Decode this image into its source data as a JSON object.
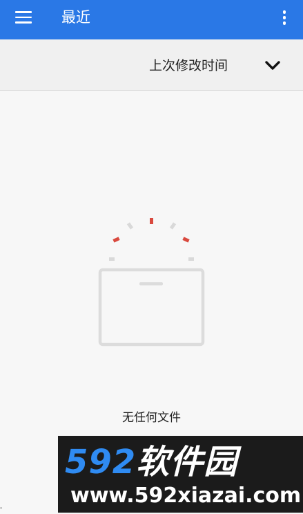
{
  "header": {
    "title": "最近",
    "menu_icon": "menu-icon",
    "more_icon": "more-vert-icon",
    "background_color": "#2a78e6"
  },
  "sort_bar": {
    "label": "上次修改时间",
    "toggle_icon": "chevron-down-icon"
  },
  "empty_state": {
    "illustration": "empty-folder-icon",
    "message": "无任何文件"
  },
  "watermark": {
    "logo_number": "592",
    "logo_text": "软件园",
    "url": "www.592xiazai.com",
    "logo_color": "#2f8bf2"
  }
}
